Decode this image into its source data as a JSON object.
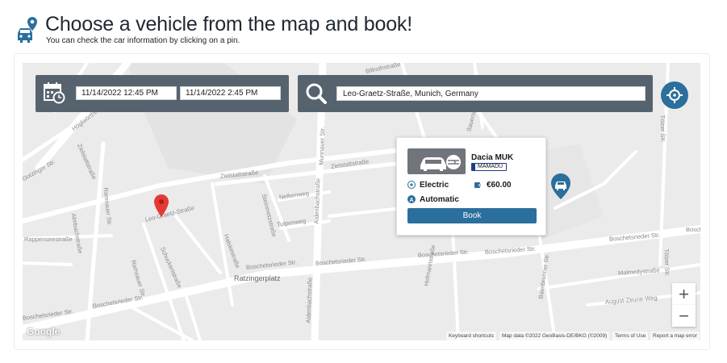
{
  "header": {
    "title": "Choose a vehicle from the map and book!",
    "subtitle": "You can check the car information by clicking on a pin.",
    "icon": "car-location-pin-icon"
  },
  "search": {
    "start_datetime": "11/14/2022 12:45 PM",
    "end_datetime": "11/14/2022 2:45 PM",
    "location": "Leo-Graetz-Straße, Munich, Germany",
    "calendar_icon": "calendar-clock-icon",
    "search_icon": "search-icon",
    "locate_icon": "crosshair-icon"
  },
  "map": {
    "streets": [
      "Billrothstraße",
      "Ratzingerplatz",
      "Zielstattstraße",
      "Zielstattstraße",
      "Nelkenweg",
      "Tulpenweg",
      "Leo-Graetz-Straße",
      "Boschetsrieder Str.",
      "Boschetsrieder Str.",
      "Boschetsrieder Str.",
      "Boschetsrieder Str.",
      "Boschetsrieder Str.",
      "Boschetsrieder Str.",
      "Boschetsrieder Str.",
      "Malmedystraße",
      "August-Zeune-Weg",
      "Munnauer Str.",
      "Aidenbachstraße",
      "Aidenbachstraße",
      "Ramsauer Str.",
      "Ramsauer Str.",
      "Almbachstraße",
      "Rappenseestraße",
      "Schuckertstraße",
      "Halskestraße",
      "Steinmetzstraße",
      "Zielstattstraße",
      "Hofmannstraße",
      "Baierbrunner Str.",
      "Tölzer Str.",
      "Tölzer Str.",
      "Höglwörther Str.",
      "Bosche",
      "ßauerstraße",
      "Gotzinger Str."
    ],
    "zoom_in": "+",
    "zoom_out": "−",
    "logo": "Google",
    "attribution": {
      "shortcuts": "Keyboard shortcuts",
      "map_data": "Map data ©2022 GeoBasis-DE/BKG (©2009)",
      "terms": "Terms of Use",
      "report": "Report a map error"
    }
  },
  "vehicle_popup": {
    "name": "Dacia MUK",
    "plate": "MAMADU",
    "fuel": "Electric",
    "price": "€60.00",
    "transmission": "Automatic",
    "book_label": "Book"
  },
  "colors": {
    "panel": "#56636f",
    "accent": "#2b6f9c",
    "map_bg": "#ebebeb",
    "pin_red": "#e53935"
  }
}
